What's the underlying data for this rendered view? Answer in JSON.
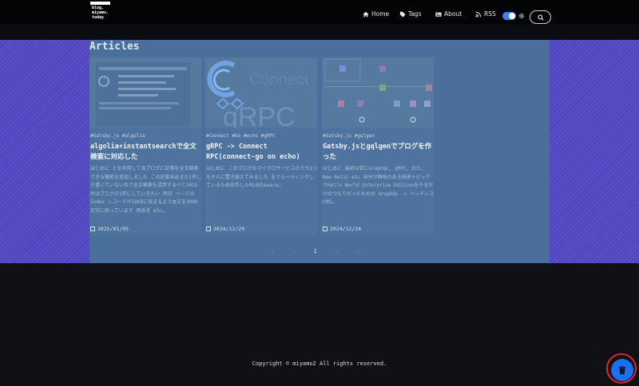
{
  "header": {
    "logo_text": "blog.\nmiyamo.\ntoday",
    "nav": [
      {
        "label": "Home",
        "icon": "home-icon"
      },
      {
        "label": "Tags",
        "icon": "tag-icon"
      },
      {
        "label": "About",
        "icon": "about-icon"
      },
      {
        "label": "RSS",
        "icon": "rss-icon"
      }
    ],
    "theme_toggle": "on"
  },
  "main": {
    "section_title": "Articles",
    "articles": [
      {
        "tags": "#Gatsby.js  #algolia",
        "title": "algolia+instantsearchで全文検索に対応した",
        "excerpt": "はじめに とを利用して当ブログに記事を全文検索できる機能を追加しました この記事含めまだ1件しか書いていないので全文検索を活用するべく2025年はブログの1年にしていきたい 所存 ページのIndex レコードが10KBに収まるよう本文を3000文字に絞っています 具体手 etc…",
        "date": "2025/01/05"
      },
      {
        "tags": "#Connect  #Go  #echo  #gRPC",
        "title": "gRPC -> Connect RPC(connect-go on echo)",
        "excerpt": "はじめに このブログのマイクロサービスのうち1つをからに置き換えてみました をでルーティングしているため自作したMiddleware…",
        "date": "2024/12/29"
      },
      {
        "tags": "#Gatsby.js  #gqlgen",
        "title": "Gatsby.jsとgqlgenでブログを作った",
        "excerpt": "はじめに 最初は単にGraphQL, gRPC, ECS, New Relic etc 自分が興味のある技術トピックでHello World Enterprise Editionをやるだけのつもりだったものの GraphQL -> ヘッドレスCMS…",
        "date": "2024/12/24"
      }
    ],
    "pagination": [
      "«",
      "‹",
      "1",
      "›",
      "»"
    ]
  },
  "footer": {
    "copyright": "Copyright © miyamo2 All rights reserved."
  },
  "colors": {
    "accent": "#1e6ff0",
    "overlay": "#4a6f9a",
    "highlight_ring": "#e0262b"
  }
}
